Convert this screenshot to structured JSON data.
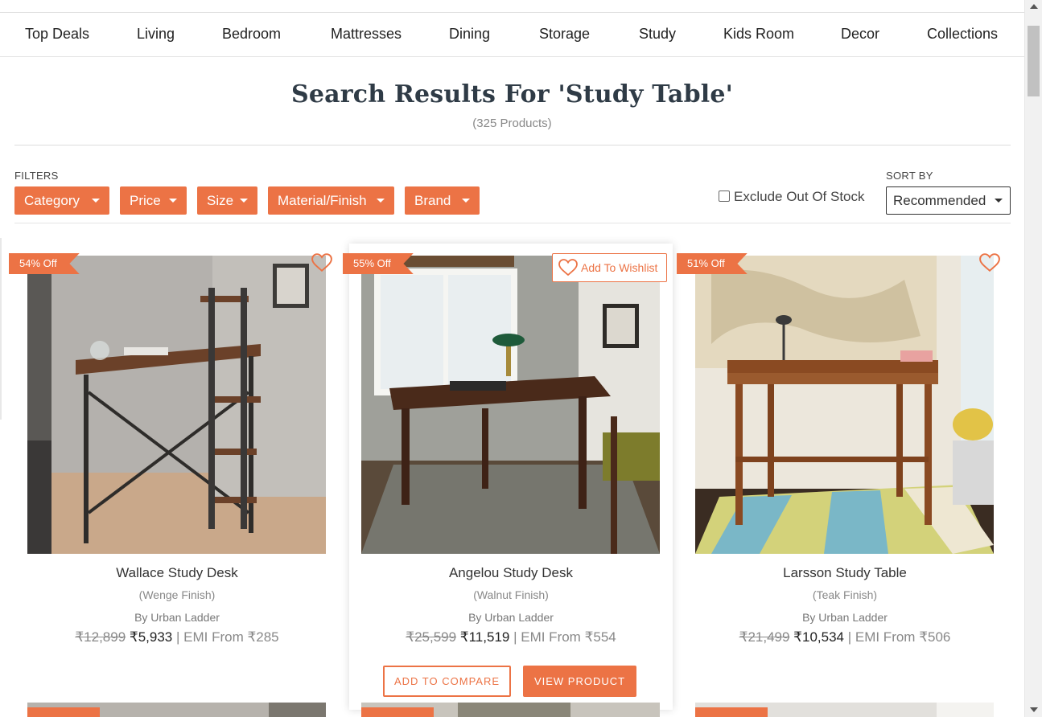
{
  "nav": {
    "items": [
      "Top Deals",
      "Living",
      "Bedroom",
      "Mattresses",
      "Dining",
      "Storage",
      "Study",
      "Kids Room",
      "Decor",
      "Collections"
    ]
  },
  "search": {
    "title": "Search Results For 'Study Table'",
    "count": "(325 Products)"
  },
  "filters": {
    "label": "FILTERS",
    "buttons": [
      "Category",
      "Price",
      "Size",
      "Material/Finish",
      "Brand"
    ],
    "exclude_out_of_stock": "Exclude Out Of Stock",
    "exclude_checked": false
  },
  "sort": {
    "label": "SORT BY",
    "selected": "Recommended"
  },
  "products": [
    {
      "discount": "54% Off",
      "name": "Wallace Study Desk",
      "finish": "(Wenge Finish)",
      "brand": "By Urban Ladder",
      "old_price": "₹12,899",
      "price": "₹5,933",
      "emi": "| EMI From ₹285"
    },
    {
      "discount": "55% Off",
      "name": "Angelou Study Desk",
      "finish": "(Walnut Finish)",
      "brand": "By Urban Ladder",
      "old_price": "₹25,599",
      "price": "₹11,519",
      "emi": "| EMI From ₹554",
      "wishlist_label": "Add To Wishlist",
      "compare_label": "ADD TO COMPARE",
      "view_label": "VIEW PRODUCT"
    },
    {
      "discount": "51% Off",
      "name": "Larsson Study Table",
      "finish": "(Teak Finish)",
      "brand": "By Urban Ladder",
      "old_price": "₹21,499",
      "price": "₹10,534",
      "emi": "| EMI From ₹506"
    }
  ],
  "colors": {
    "accent": "#ec7345",
    "title": "#2f3b46"
  },
  "icons": [
    "heart-icon",
    "caret-down-icon",
    "checkbox-icon"
  ]
}
